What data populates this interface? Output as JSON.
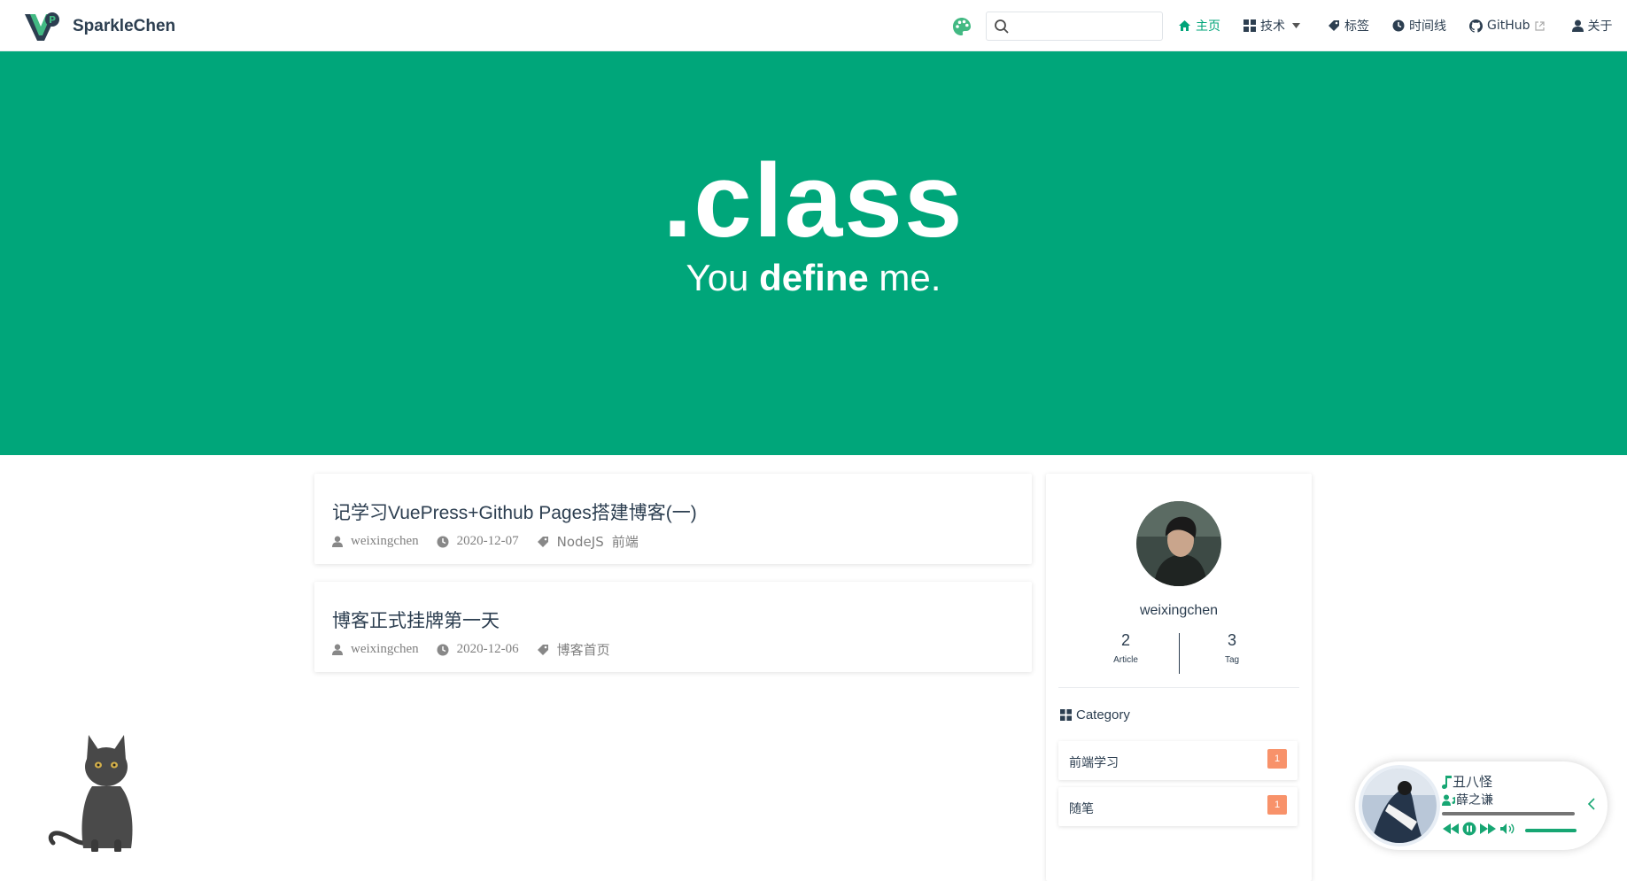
{
  "brand": {
    "name": "SparkleChen"
  },
  "search": {
    "placeholder": ""
  },
  "nav": {
    "items": [
      {
        "label": "主页",
        "icon": "home-icon"
      },
      {
        "label": "技术",
        "icon": "grid-icon"
      },
      {
        "label": "标签",
        "icon": "tag-icon"
      },
      {
        "label": "时间线",
        "icon": "clock-icon"
      },
      {
        "label": "GitHub",
        "icon": "github-icon"
      },
      {
        "label": "关于",
        "icon": "user-icon"
      }
    ]
  },
  "hero": {
    "title": ".class",
    "sub_pre": "You ",
    "sub_bold": "define",
    "sub_post": " me."
  },
  "posts": [
    {
      "title": "记学习VuePress+Github Pages搭建博客(一)",
      "author": "weixingchen",
      "date": "2020-12-07",
      "tags": [
        "NodeJS",
        "前端"
      ]
    },
    {
      "title": "博客正式挂牌第一天",
      "author": "weixingchen",
      "date": "2020-12-06",
      "tags": [
        "博客首页"
      ]
    }
  ],
  "profile": {
    "name": "weixingchen",
    "article_count": "2",
    "article_label": "Article",
    "tag_count": "3",
    "tag_label": "Tag"
  },
  "category": {
    "heading": "Category",
    "items": [
      {
        "name": "前端学习",
        "count": "1"
      },
      {
        "name": "随笔",
        "count": "1"
      }
    ]
  },
  "player": {
    "song": "丑八怪",
    "artist": "薛之谦"
  },
  "colors": {
    "accent": "#00a67a",
    "badge": "#f8926a",
    "text": "#2c3e50"
  }
}
